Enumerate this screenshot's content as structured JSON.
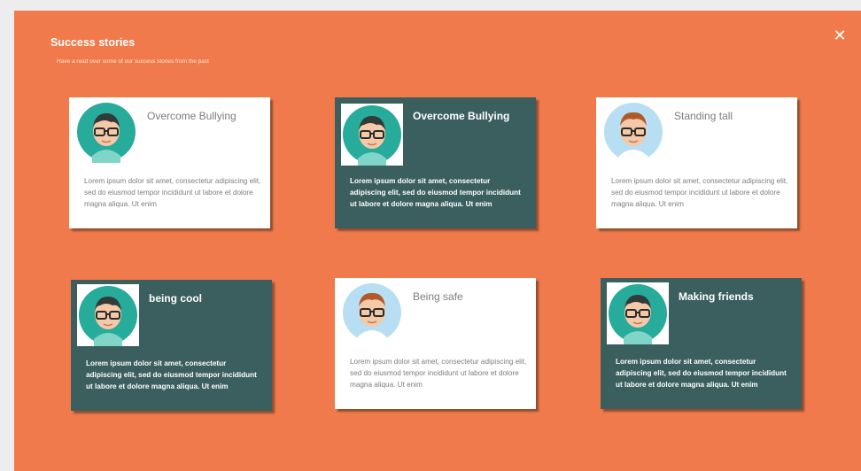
{
  "modal": {
    "title": "Success stories",
    "subtitle": "Have a read over some of our success stories from the past",
    "close_icon": "✕"
  },
  "cards": [
    {
      "title": "Overcome Bullying",
      "style": "light",
      "avatar": "teal-avatar",
      "body": "Lorem ipsum dolor sit amet, consectetur adipiscing elit, sed do eiusmod tempor incididunt ut labore et dolore magna aliqua. Ut enim"
    },
    {
      "title": "Overcome Bullying",
      "style": "dark",
      "avatar": "teal-avatar",
      "body": "Lorem ipsum dolor sit amet, consectetur adipiscing elit, sed do eiusmod tempor incididunt ut labore et dolore magna aliqua. Ut enim"
    },
    {
      "title": "Standing tall",
      "style": "light",
      "avatar": "blue-avatar",
      "body": "Lorem ipsum dolor sit amet, consectetur adipiscing elit, sed do eiusmod tempor incididunt ut labore et dolore magna aliqua. Ut enim"
    },
    {
      "title": "being cool",
      "style": "dark",
      "avatar": "teal-avatar",
      "body": "Lorem ipsum dolor sit amet, consectetur adipiscing elit, sed do eiusmod tempor incididunt ut labore et dolore magna aliqua. Ut enim"
    },
    {
      "title": "Being safe",
      "style": "light",
      "avatar": "blue-avatar",
      "body": "Lorem ipsum dolor sit amet, consectetur adipiscing elit, sed do eiusmod tempor incididunt ut labore et dolore magna aliqua. Ut enim"
    },
    {
      "title": "Making friends",
      "style": "dark",
      "avatar": "teal-avatar",
      "body": "Lorem ipsum dolor sit amet, consectetur adipiscing elit, sed do eiusmod tempor incididunt ut labore et dolore magna aliqua. Ut enim"
    }
  ],
  "colors": {
    "background": "#f07a4b",
    "card_dark": "#3b5f5f",
    "card_light": "#ffffff",
    "avatar_teal": "#27ab9a",
    "avatar_blue": "#b8def4"
  }
}
